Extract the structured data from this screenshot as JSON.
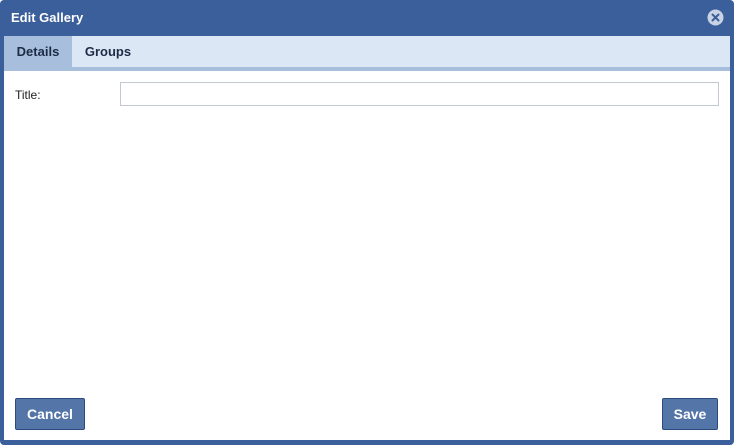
{
  "dialog": {
    "title": "Edit Gallery",
    "close_icon": "close-circle-icon"
  },
  "tabs": [
    {
      "label": "Details",
      "active": true
    },
    {
      "label": "Groups",
      "active": false
    }
  ],
  "form": {
    "title_label": "Title:",
    "title_value": "",
    "title_placeholder": ""
  },
  "footer": {
    "cancel_label": "Cancel",
    "save_label": "Save"
  },
  "colors": {
    "frame": "#3b5f9b",
    "tabbar": "#dce7f5",
    "active_tab": "#a7bedd",
    "button": "#5475a8"
  }
}
